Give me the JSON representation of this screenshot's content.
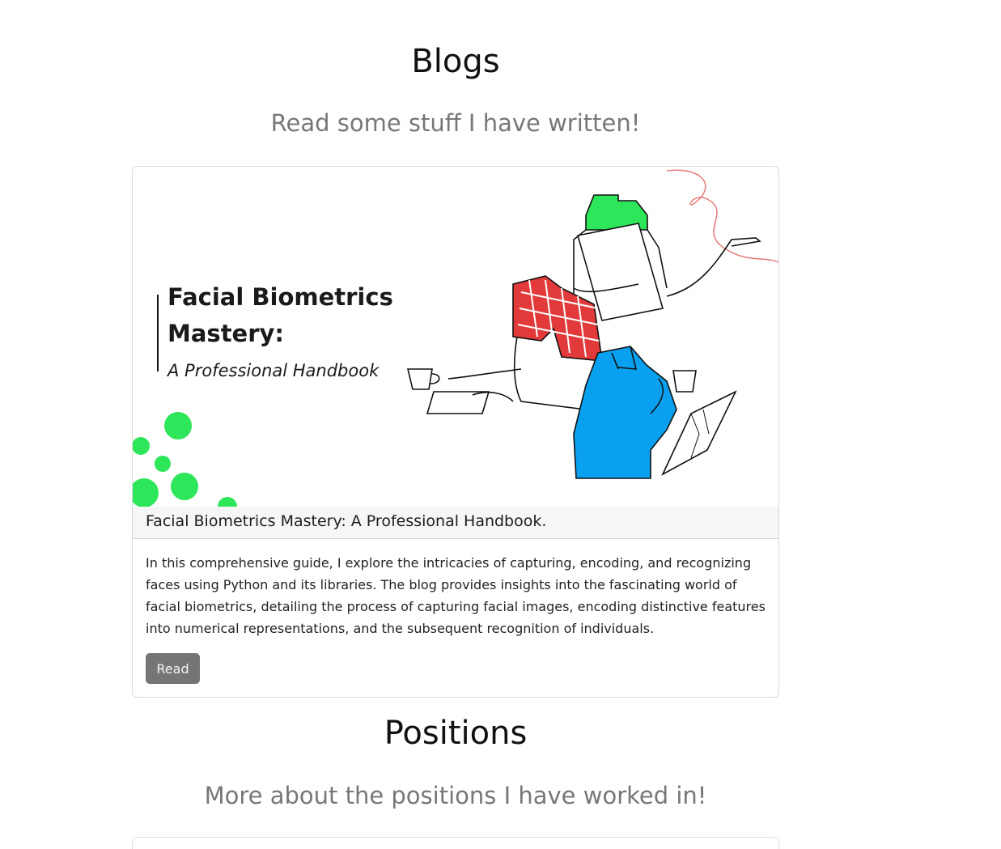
{
  "blogs": {
    "title": "Blogs",
    "subtitle": "Read some stuff I have written!",
    "posts": [
      {
        "image_title_line1": "Facial Biometrics",
        "image_title_line2": "Mastery:",
        "image_subtitle": "A Professional Handbook",
        "title": "Facial Biometrics Mastery: A Professional Handbook.",
        "description": "In this comprehensive guide, I explore the intricacies of capturing, encoding, and recognizing faces using Python and its libraries. The blog provides insights into the fascinating world of facial biometrics, detailing the process of capturing facial images, encoding distinctive features into numerical representations, and the subsequent recognition of individuals.",
        "button_label": "Read"
      }
    ]
  },
  "positions": {
    "title": "Positions",
    "subtitle": "More about the positions I have worked in!"
  },
  "colors": {
    "accent_green": "#2ee65a",
    "shirt_blue": "#0aa0f0",
    "scarf_red": "#e23a3a",
    "button_gray": "#757575"
  }
}
